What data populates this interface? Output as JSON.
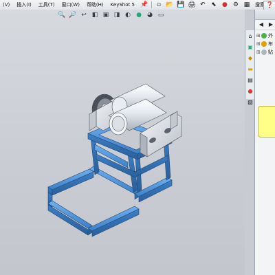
{
  "menu": {
    "items": [
      "(V)",
      "插入(I)",
      "工具(T)",
      "窗口(W)",
      "帮助(H)",
      "KeyShot 5"
    ],
    "search_label": "搜索"
  },
  "toolbar": {
    "icons": [
      "pin-icon",
      "new-icon",
      "open-icon",
      "save-icon",
      "print-icon",
      "undo-icon",
      "select-icon",
      "traffic-light-icon",
      "options-icon",
      "grid-icon"
    ]
  },
  "viewbar": {
    "icons": [
      "zoom-to-fit-icon",
      "zoom-area-icon",
      "previous-view-icon",
      "section-view-icon",
      "view-orientation-icon",
      "display-style-icon",
      "hide-show-icon",
      "edit-appearance-icon",
      "apply-scene-icon",
      "view-settings-icon"
    ]
  },
  "taskpane": {
    "rows": [
      {
        "label": "外"
      },
      {
        "label": "布"
      },
      {
        "label": "贴"
      }
    ],
    "colors": {
      "note": "#ffff88"
    }
  },
  "colors": {
    "frame": "#4a8fd6",
    "rollers": "#dfe3e8",
    "viewport": "#c9ccd2"
  }
}
